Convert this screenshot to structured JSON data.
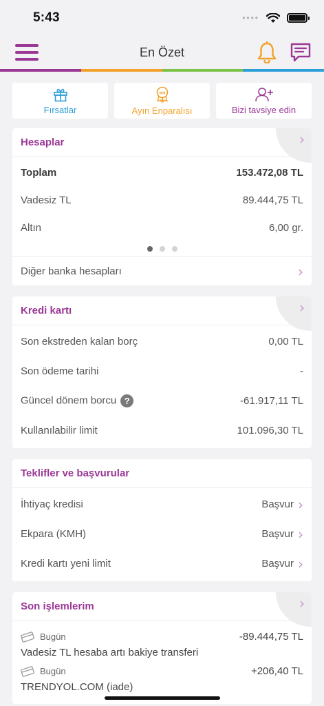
{
  "status": {
    "time": "5:43"
  },
  "nav": {
    "title": "En Özet"
  },
  "colors": {
    "brand": "#9b3896",
    "bar": [
      "#9b3896",
      "#f2a12a",
      "#7cc247",
      "#2c9fd9"
    ]
  },
  "quick": [
    {
      "label": "Fırsatlar",
      "icon": "gift-icon",
      "color": "#2c9fd9"
    },
    {
      "label": "Ayın Enparalısı",
      "icon": "badge-icon",
      "color": "#f2a12a"
    },
    {
      "label": "Bizi tavsiye edin",
      "icon": "add-user-icon",
      "color": "#9b3896"
    }
  ],
  "accounts": {
    "title": "Hesaplar",
    "rows": [
      {
        "label": "Toplam",
        "value": "153.472,08 TL"
      },
      {
        "label": "Vadesiz TL",
        "value": "89.444,75 TL"
      },
      {
        "label": "Altın",
        "value": "6,00 gr."
      }
    ],
    "other": "Diğer banka hesapları"
  },
  "credit": {
    "title": "Kredi kartı",
    "rows": [
      {
        "label": "Son ekstreden kalan borç",
        "value": "0,00 TL"
      },
      {
        "label": "Son ödeme tarihi",
        "value": "-"
      },
      {
        "label": "Güncel dönem borcu",
        "value": "-61.917,11 TL"
      },
      {
        "label": "Kullanılabilir limit",
        "value": "101.096,30 TL"
      }
    ]
  },
  "offers": {
    "title": "Teklifler ve başvurular",
    "rows": [
      {
        "label": "İhtiyaç kredisi",
        "action": "Başvur"
      },
      {
        "label": "Ekpara (KMH)",
        "action": "Başvur"
      },
      {
        "label": "Kredi kartı yeni limit",
        "action": "Başvur"
      }
    ]
  },
  "transactions": {
    "title": "Son işlemlerim",
    "items": [
      {
        "date": "Bugün",
        "amount": "-89.444,75 TL",
        "desc": "Vadesiz TL hesaba artı bakiye transferi"
      },
      {
        "date": "Bugün",
        "amount": "+206,40 TL",
        "desc": "TRENDYOL.COM (iade)"
      }
    ]
  }
}
